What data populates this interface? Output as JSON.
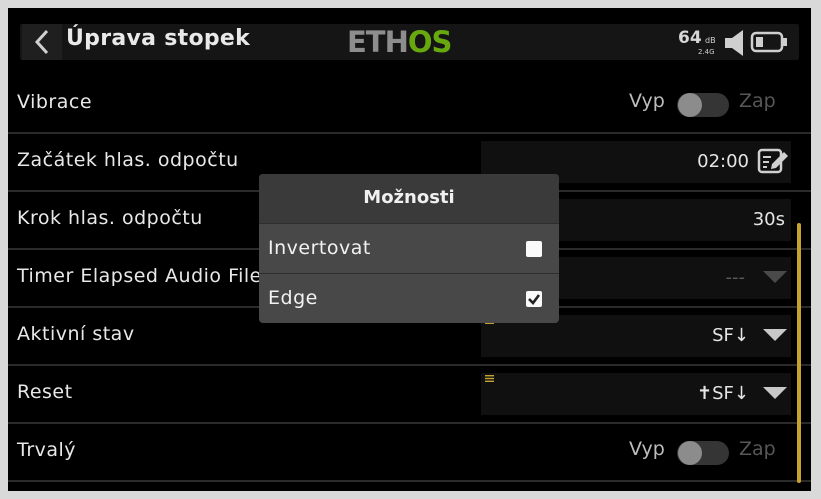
{
  "header": {
    "title": "Úprava stopek",
    "brand_part1": "ETH",
    "brand_part2": "OS",
    "rssi_value": "64",
    "rssi_unit": "dB",
    "rssi_band": "2.4G",
    "icons": [
      "back-arrow-icon",
      "speaker-icon",
      "battery-icon"
    ]
  },
  "rows": [
    {
      "label": "Vibrace",
      "off_label": "Vyp",
      "on_label": "Zap",
      "state": "off"
    },
    {
      "label": "Začátek hlas. odpočtu",
      "value": "02:00",
      "icon": "edit-icon"
    },
    {
      "label": "Krok hlas. odpočtu",
      "value": "30s"
    },
    {
      "label": "Timer Elapsed Audio File",
      "value": "---"
    },
    {
      "label": "Aktivní stav",
      "value": "SF↓"
    },
    {
      "label": "Reset",
      "value": "✝SF↓"
    },
    {
      "label": "Trvalý",
      "off_label": "Vyp",
      "on_label": "Zap",
      "state": "off"
    }
  ],
  "popup": {
    "title": "Možnosti",
    "options": [
      {
        "label": "Invertovat",
        "checked": false
      },
      {
        "label": "Edge",
        "checked": true
      }
    ]
  },
  "colors": {
    "accent_green": "#67a80f",
    "scrollbar": "#c4a32f",
    "background": "#000000"
  }
}
